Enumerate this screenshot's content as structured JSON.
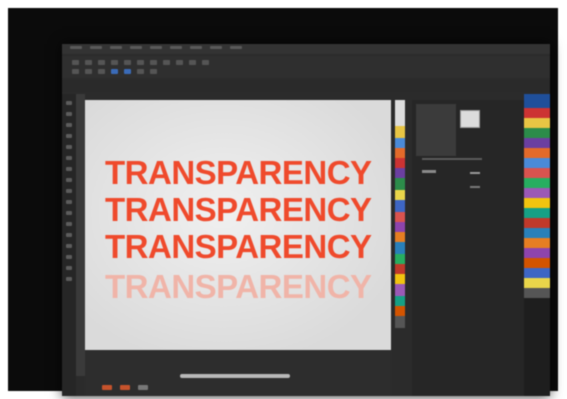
{
  "canvas": {
    "lines": [
      {
        "text": "TRANSPARENCY",
        "opacity_percent": 100
      },
      {
        "text": "TRANSPARENCY",
        "opacity_percent": 100
      },
      {
        "text": "TRANSPARENCY",
        "opacity_percent": 100
      },
      {
        "text": "TRANSPARENCY",
        "opacity_percent": 35
      }
    ]
  },
  "colors": {
    "text_accent": "#ef4a2c",
    "text_faded": "#f0b4a8",
    "ui_background": "#2b2b2b",
    "canvas_background": "#e2e2e2"
  },
  "icons": {
    "menu": "menu-bar-items",
    "toolbar": "toolbar-icons",
    "docker_preview": "object-thumbnail-icon"
  }
}
